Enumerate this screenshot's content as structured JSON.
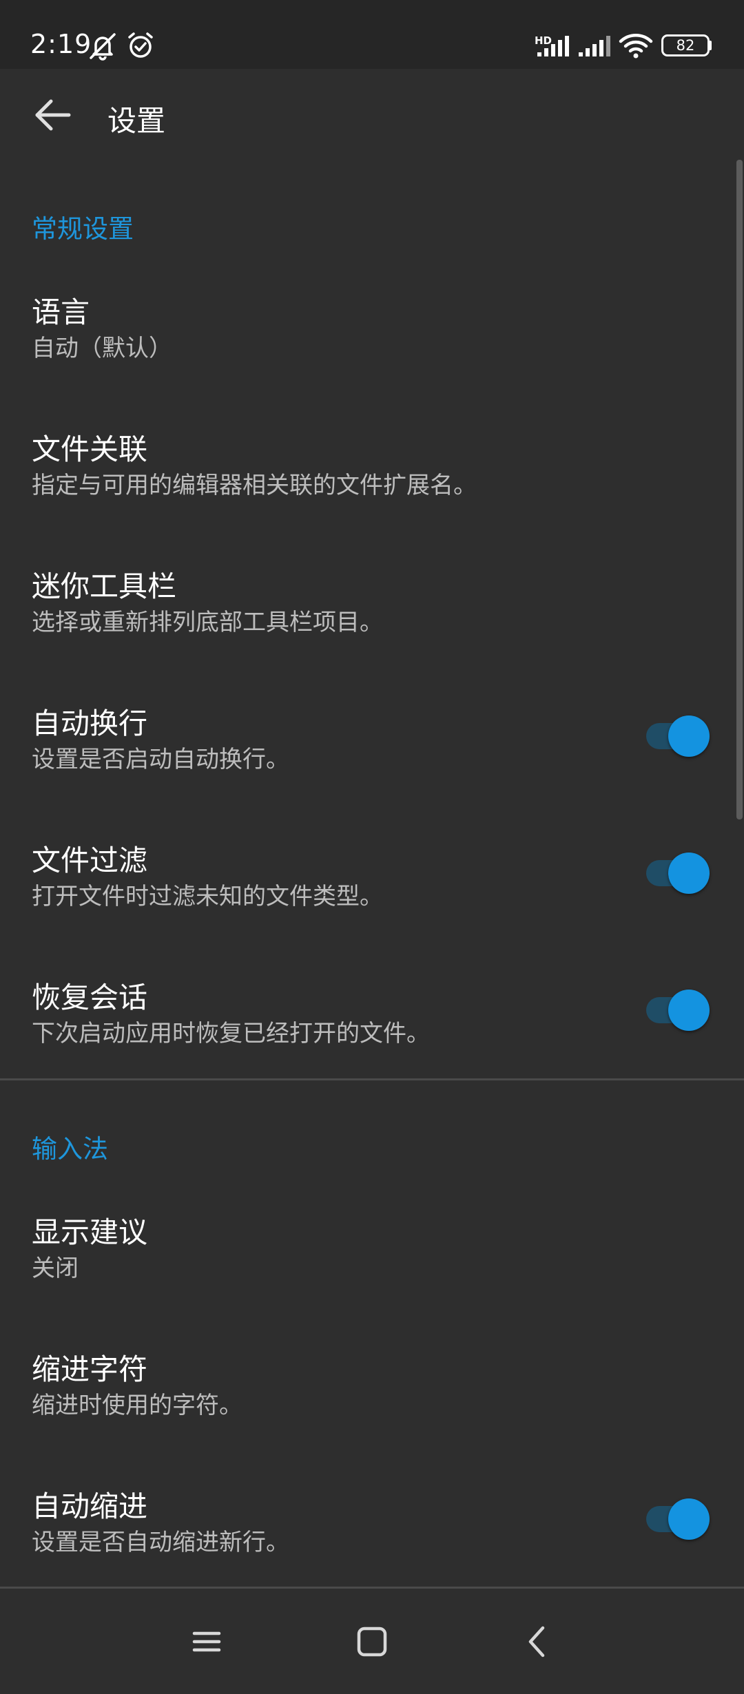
{
  "status_bar": {
    "time": "2:19",
    "battery": "82",
    "network_badge": "HD",
    "icons": [
      "mute-icon",
      "alarm-icon",
      "signal-icon",
      "signal-icon",
      "wifi-icon",
      "battery-icon"
    ]
  },
  "app_bar": {
    "title": "设置",
    "back_icon": "arrow-left-icon"
  },
  "sections": [
    {
      "header": "常规设置",
      "items": [
        {
          "title": "语言",
          "subtitle": "自动（默认）",
          "toggle": null
        },
        {
          "title": "文件关联",
          "subtitle": "指定与可用的编辑器相关联的文件扩展名。",
          "toggle": null
        },
        {
          "title": "迷你工具栏",
          "subtitle": "选择或重新排列底部工具栏项目。",
          "toggle": null
        },
        {
          "title": "自动换行",
          "subtitle": "设置是否启动自动换行。",
          "toggle": true
        },
        {
          "title": "文件过滤",
          "subtitle": "打开文件时过滤未知的文件类型。",
          "toggle": true
        },
        {
          "title": "恢复会话",
          "subtitle": "下次启动应用时恢复已经打开的文件。",
          "toggle": true
        }
      ]
    },
    {
      "header": "输入法",
      "items": [
        {
          "title": "显示建议",
          "subtitle": "关闭",
          "toggle": null
        },
        {
          "title": "缩进字符",
          "subtitle": "缩进时使用的字符。",
          "toggle": null
        },
        {
          "title": "自动缩进",
          "subtitle": "设置是否自动缩进新行。",
          "toggle": true
        }
      ]
    }
  ],
  "nav_bar": {
    "icons": [
      "menu-icon",
      "home-icon",
      "back-icon"
    ]
  },
  "colors": {
    "background": "#2e2e2e",
    "status_bar": "#262626",
    "accent": "#1e96dc",
    "toggle_thumb": "#1493e0",
    "toggle_track": "#1f4d66",
    "subtitle": "#bdbdbd",
    "divider": "#4a4a4a"
  }
}
